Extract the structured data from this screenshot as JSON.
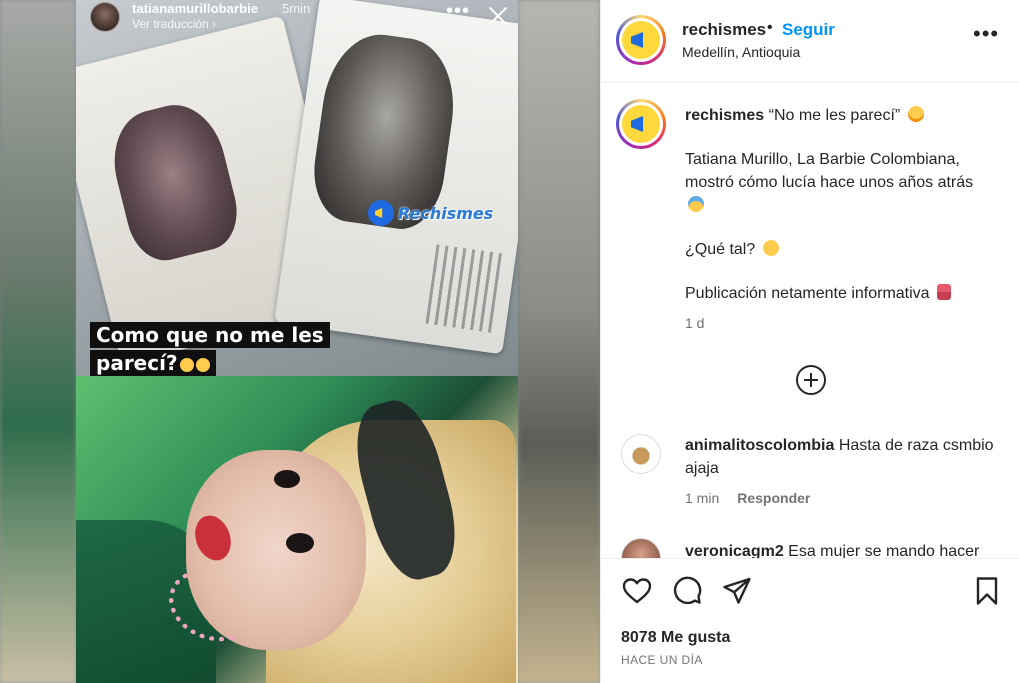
{
  "story": {
    "username": "tatianamurillobarbie",
    "time": "5min",
    "translate": "Ver traducción  ›",
    "more": "•••",
    "caption_line1": "Como que no me les",
    "caption_line2": "parecí?",
    "watermark": "Rechismes"
  },
  "post": {
    "username": "rechismes",
    "dot": "•",
    "follow": "Seguir",
    "location": "Medellín, Antioquia",
    "more": "•••"
  },
  "caption": {
    "username": "rechismes",
    "title": " “No me les parecí” ",
    "para1": "Tatiana Murillo, La Barbie Colombiana, mostró cómo lucía hace unos años atrás ",
    "para2": "¿Qué tal? ",
    "para3": "Publicación netamente informativa ",
    "time": "1 d"
  },
  "comments": [
    {
      "username": "animalitoscolombia",
      "text": " Hasta de raza csmbio ajaja",
      "time": "1 min",
      "reply": "Responder"
    },
    {
      "username": "veronicagm2",
      "text": " Esa mujer se mando hacer"
    }
  ],
  "footer": {
    "likes": "8078 Me gusta",
    "when": "HACE UN DÍA"
  },
  "colors": {
    "follow": "#0095f6",
    "text": "#262626",
    "muted": "#737373",
    "border": "#efefef"
  },
  "icons": [
    "close-icon",
    "more-icon",
    "add-comment-circle-icon",
    "heart-icon",
    "comment-icon",
    "share-icon",
    "bookmark-icon"
  ]
}
